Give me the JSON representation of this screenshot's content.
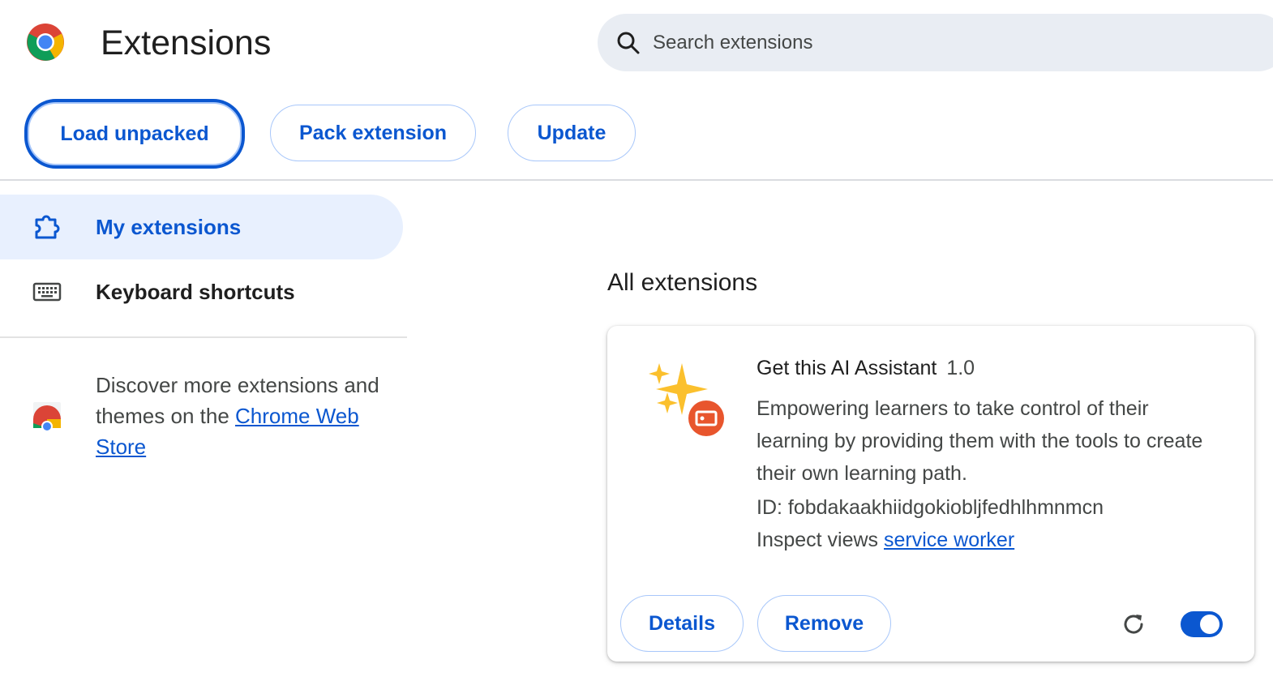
{
  "header": {
    "title": "Extensions",
    "logo_icon": "chrome-logo-icon"
  },
  "search": {
    "placeholder": "Search extensions",
    "icon": "search-icon"
  },
  "toolbar": {
    "load_unpacked": "Load unpacked",
    "pack_extension": "Pack extension",
    "update": "Update"
  },
  "sidebar": {
    "items": [
      {
        "label": "My extensions",
        "icon": "puzzle-icon",
        "active": true
      },
      {
        "label": "Keyboard shortcuts",
        "icon": "keyboard-icon",
        "active": false
      }
    ],
    "discover_text": "Discover more extensions and themes on the ",
    "store_link": "Chrome Web Store",
    "store_icon": "chrome-web-store-icon"
  },
  "main": {
    "section_title": "All extensions",
    "extension": {
      "name": "Get this AI Assistant",
      "version": "1.0",
      "description": "Empowering learners to take control of their learning by providing them with the tools to create their own learning path.",
      "id_text": "ID: fobdakaakhiidgokiobljfedhlhmnmcn",
      "inspect_label": "Inspect views ",
      "inspect_link": "service worker",
      "details_label": "Details",
      "remove_label": "Remove",
      "enabled": true,
      "icon": "sparkles-icon"
    }
  },
  "colors": {
    "accent": "#0b57d0",
    "active_bg": "#e8f0fe",
    "search_bg": "#e9edf3",
    "pill_border": "#a8c7fa"
  }
}
